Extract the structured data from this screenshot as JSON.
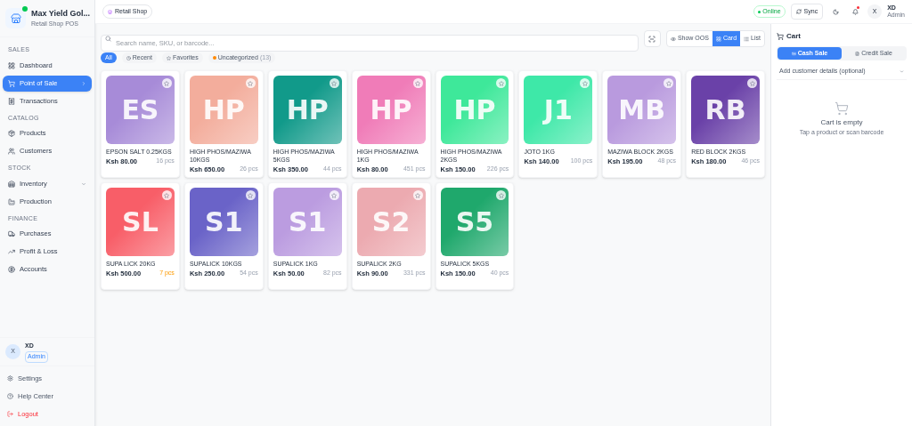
{
  "brand": {
    "name": "Max Yield Gol...",
    "subtitle": "Retail Shop POS",
    "online": true
  },
  "sidebar": {
    "sections": [
      {
        "title": "SALES",
        "items": [
          {
            "label": "Dashboard",
            "selected": false,
            "has_submenu": false
          },
          {
            "label": "Point of Sale",
            "selected": true,
            "has_submenu": false
          },
          {
            "label": "Transactions",
            "selected": false,
            "has_submenu": false
          }
        ]
      },
      {
        "title": "CATALOG",
        "items": [
          {
            "label": "Products",
            "selected": false,
            "has_submenu": false
          },
          {
            "label": "Customers",
            "selected": false,
            "has_submenu": false
          }
        ]
      },
      {
        "title": "STOCK",
        "items": [
          {
            "label": "Inventory",
            "selected": false,
            "has_submenu": true
          },
          {
            "label": "Production",
            "selected": false,
            "has_submenu": false
          }
        ]
      },
      {
        "title": "FINANCE",
        "items": [
          {
            "label": "Purchases",
            "selected": false,
            "has_submenu": false
          },
          {
            "label": "Profit & Loss",
            "selected": false,
            "has_submenu": false
          },
          {
            "label": "Accounts",
            "selected": false,
            "has_submenu": false
          }
        ]
      }
    ],
    "user": {
      "initial": "X",
      "name": "XD",
      "role": "Admin"
    },
    "footer": [
      {
        "label": "Settings",
        "kind": "settings"
      },
      {
        "label": "Help Center",
        "kind": "help"
      },
      {
        "label": "Logout",
        "kind": "logout"
      }
    ]
  },
  "topbar": {
    "shop": "Retail Shop",
    "status": "Online",
    "sync": "Sync",
    "notification": true,
    "user": {
      "initial": "X",
      "name": "XD",
      "role": "Admin"
    }
  },
  "search": {
    "placeholder": "Search name, SKU, or barcode..."
  },
  "view": [
    {
      "label": "Show OOS",
      "selected": false
    },
    {
      "label": "Card",
      "selected": true
    },
    {
      "label": "List",
      "selected": false
    }
  ],
  "filters": [
    {
      "label": "All",
      "selected": true,
      "kind": "all"
    },
    {
      "label": "Recent",
      "selected": false,
      "kind": "recent"
    },
    {
      "label": "Favorites",
      "selected": false,
      "kind": "favorites"
    },
    {
      "label": "Uncategorized",
      "count": "(13)",
      "selected": false,
      "kind": "category"
    }
  ],
  "products": [
    {
      "initials": "ES",
      "name": "EPSON SALT 0.25KGS",
      "price": "Ksh 80.00",
      "stock": "16 pcs",
      "low_stock": false,
      "color": "#a78bd8"
    },
    {
      "initials": "HP",
      "name": "HIGH PHOS/MAZIWA 10KGS",
      "price": "Ksh 650.00",
      "stock": "26 pcs",
      "low_stock": false,
      "color": "#f3ad9c"
    },
    {
      "initials": "HP",
      "name": "HIGH PHOS/MAZIWA 5KGS",
      "price": "Ksh 350.00",
      "stock": "44 pcs",
      "low_stock": false,
      "color": "#119a8a"
    },
    {
      "initials": "HP",
      "name": "HIGH PHOS/MAZIWA 1KG",
      "price": "Ksh 80.00",
      "stock": "451 pcs",
      "low_stock": false,
      "color": "#f07cb8"
    },
    {
      "initials": "HP",
      "name": "HIGH PHOS/MAZIWA 2KGS",
      "price": "Ksh 150.00",
      "stock": "226 pcs",
      "low_stock": false,
      "color": "#3ee89a"
    },
    {
      "initials": "J1",
      "name": "JOTO 1KG",
      "price": "Ksh 140.00",
      "stock": "100 pcs",
      "low_stock": false,
      "color": "#3ee8a8"
    },
    {
      "initials": "MB",
      "name": "MAZIWA BLOCK 2KGS",
      "price": "Ksh 195.00",
      "stock": "48 pcs",
      "low_stock": false,
      "color": "#b99ade"
    },
    {
      "initials": "RB",
      "name": "RED BLOCK 2KGS",
      "price": "Ksh 180.00",
      "stock": "46 pcs",
      "low_stock": false,
      "color": "#6a41a8"
    },
    {
      "initials": "SL",
      "name": "SUPA LICK 20KG",
      "price": "Ksh 500.00",
      "stock": "7 pcs",
      "low_stock": true,
      "color": "#f85e68"
    },
    {
      "initials": "S1",
      "name": "SUPALICK 10KGS",
      "price": "Ksh 250.00",
      "stock": "54 pcs",
      "low_stock": false,
      "color": "#6a63c8"
    },
    {
      "initials": "S1",
      "name": "SUPALICK 1KG",
      "price": "Ksh 50.00",
      "stock": "82 pcs",
      "low_stock": false,
      "color": "#bb9ce0"
    },
    {
      "initials": "S2",
      "name": "SUPALICK 2KG",
      "price": "Ksh 90.00",
      "stock": "331 pcs",
      "low_stock": false,
      "color": "#ecaab0"
    },
    {
      "initials": "S5",
      "name": "SUPALICK 5KGS",
      "price": "Ksh 150.00",
      "stock": "40 pcs",
      "low_stock": false,
      "color": "#1fa86c"
    }
  ],
  "cart": {
    "title": "Cart",
    "tabs": [
      {
        "label": "Cash Sale",
        "selected": true
      },
      {
        "label": "Credit Sale",
        "selected": false
      }
    ],
    "customer": "Add customer details (optional)",
    "empty_title": "Cart is empty",
    "empty_hint": "Tap a product or scan barcode"
  }
}
